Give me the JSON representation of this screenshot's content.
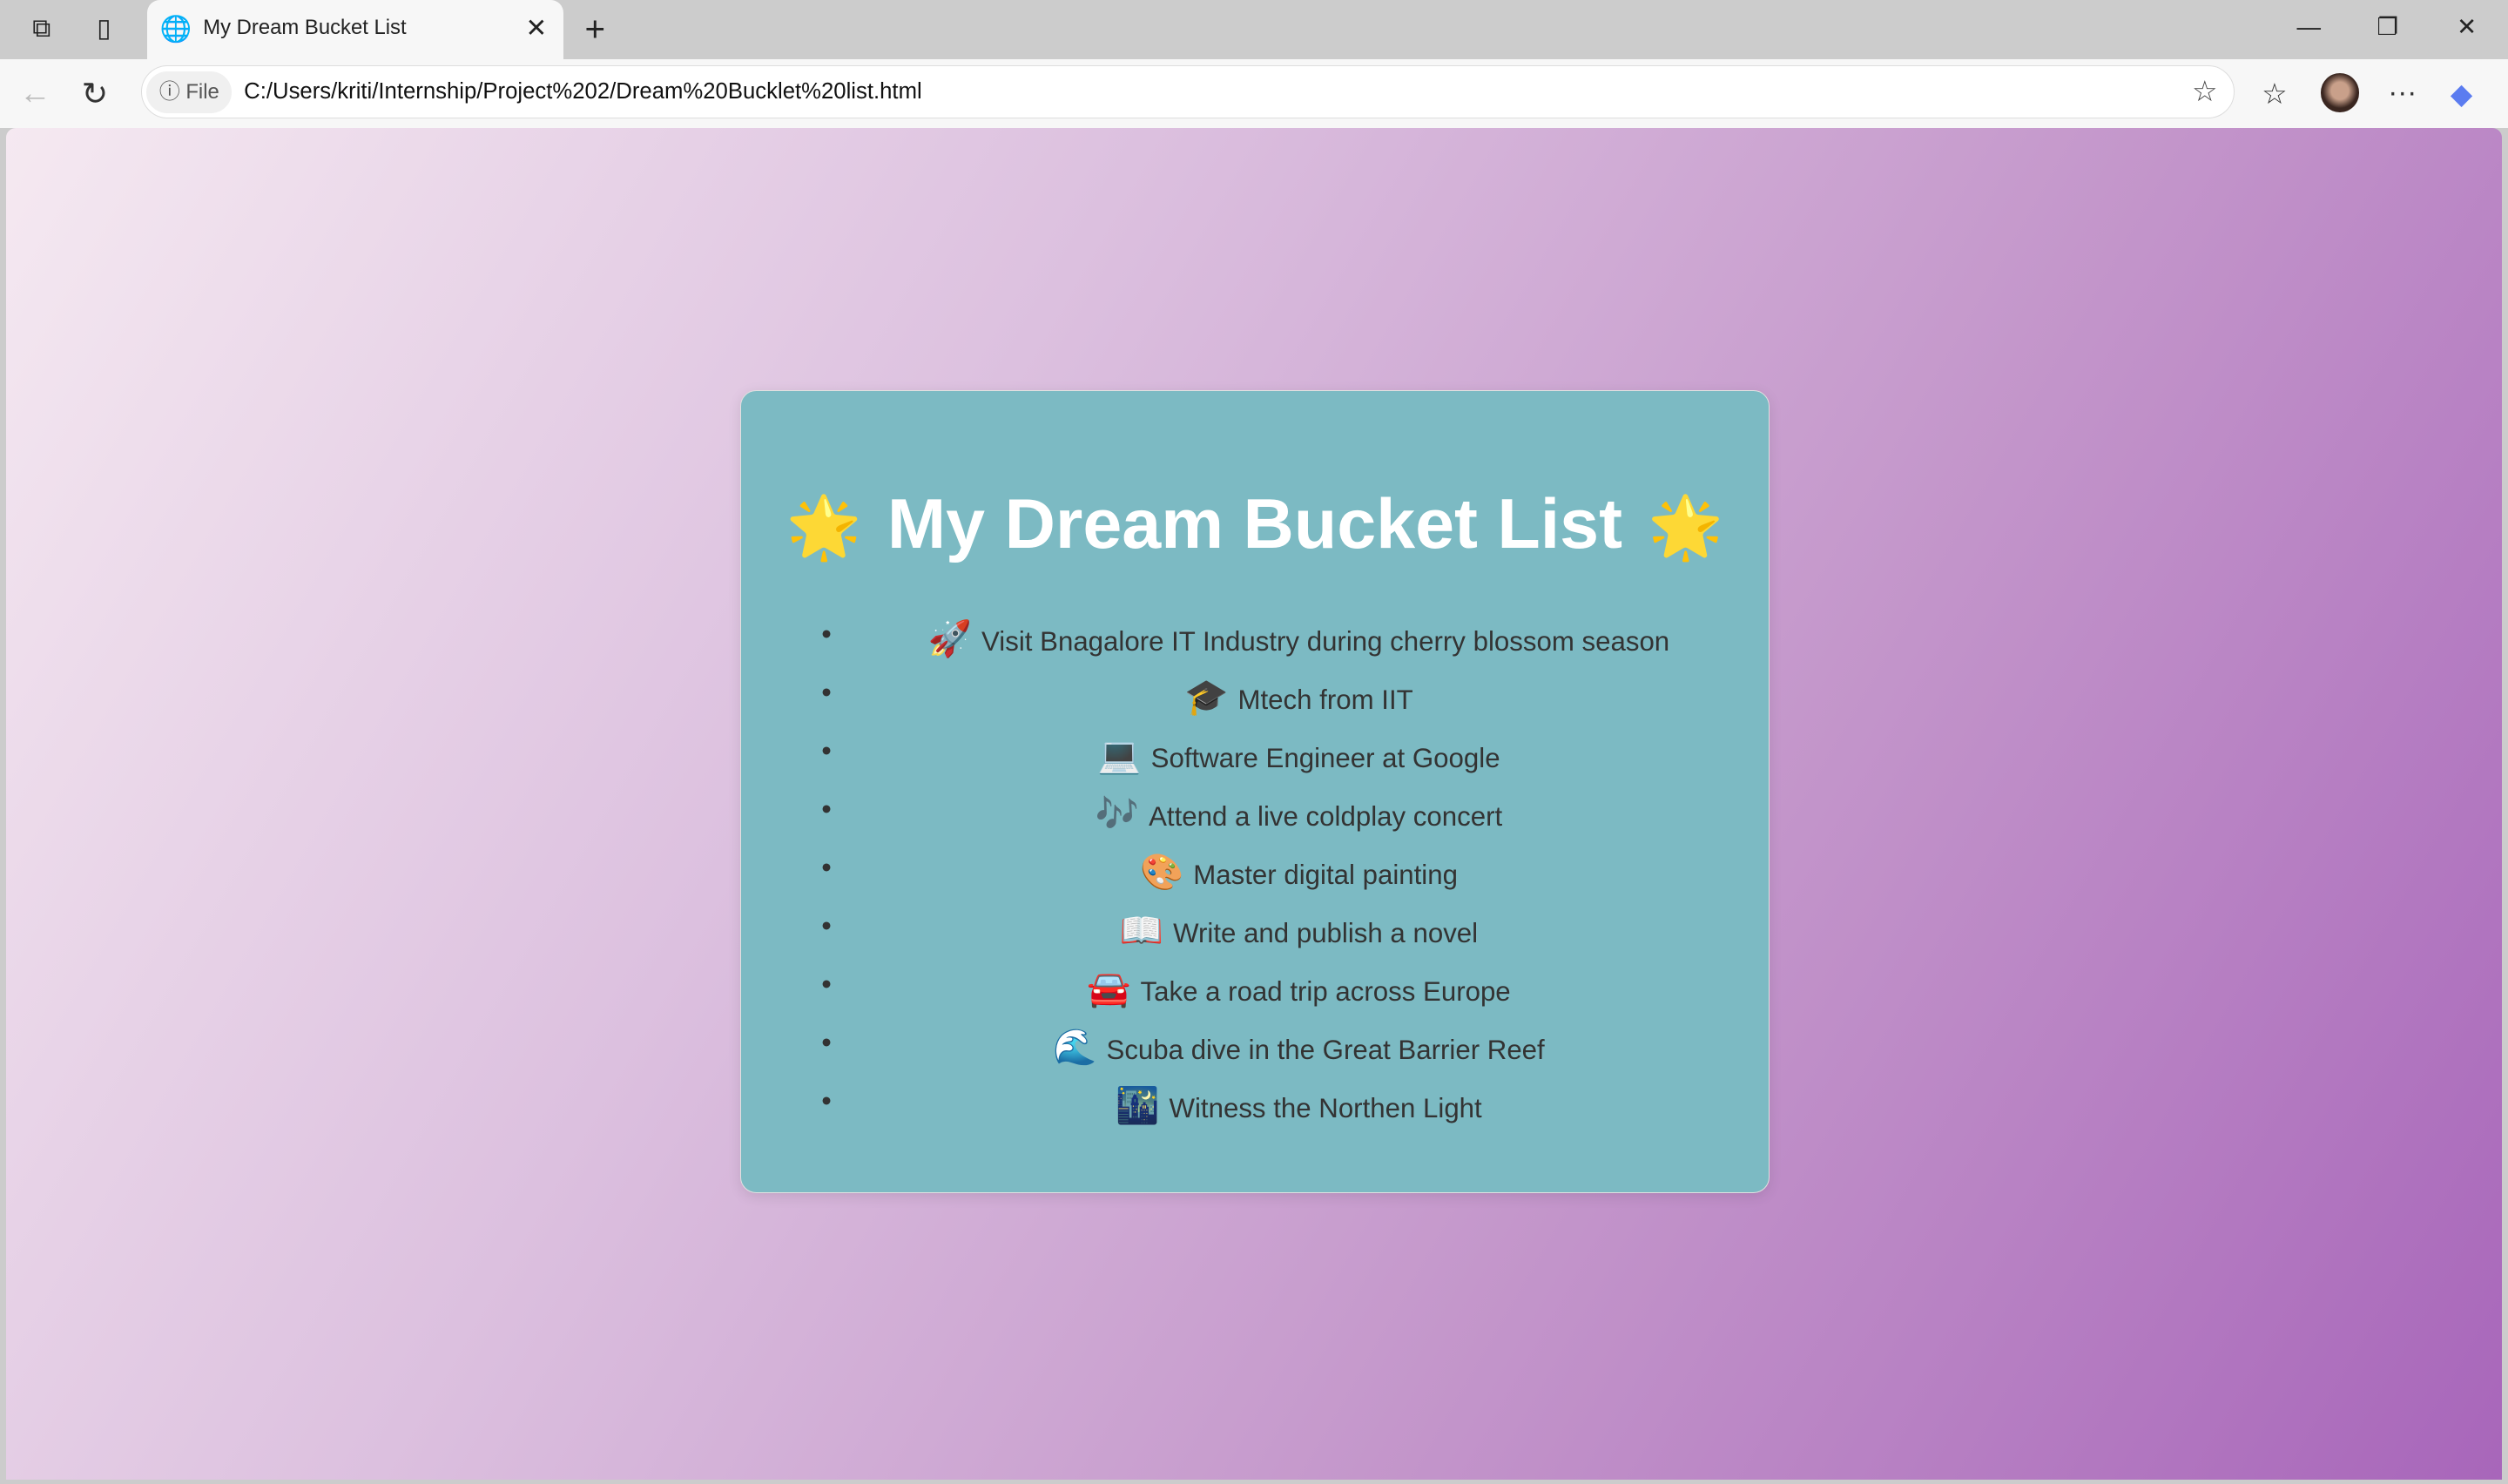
{
  "browser": {
    "tab_title": "My Dream Bucket List",
    "url": "C:/Users/kriti/Internship/Project%202/Dream%20Bucklet%20list.html",
    "file_badge": "File"
  },
  "page": {
    "title": "My Dream Bucket List",
    "title_emoji": "🌟",
    "items": [
      {
        "emoji": "🚀",
        "text": "Visit Bnagalore IT Industry during cherry blossom season"
      },
      {
        "emoji": "🎓",
        "text": "Mtech from IIT"
      },
      {
        "emoji": "💻",
        "text": "Software Engineer at Google"
      },
      {
        "emoji": "🎶",
        "text": "Attend a live coldplay concert"
      },
      {
        "emoji": "🎨",
        "text": "Master digital painting"
      },
      {
        "emoji": "📖",
        "text": "Write and publish a novel"
      },
      {
        "emoji": "🚘",
        "text": "Take a road trip across Europe"
      },
      {
        "emoji": "🌊",
        "text": "Scuba dive in the Great Barrier Reef"
      },
      {
        "emoji": "🌃",
        "text": "Witness the Northen Light"
      }
    ]
  },
  "colors": {
    "card": "#7cbac3",
    "gradient_start": "#f5e9f1",
    "gradient_end": "#a866ba"
  }
}
